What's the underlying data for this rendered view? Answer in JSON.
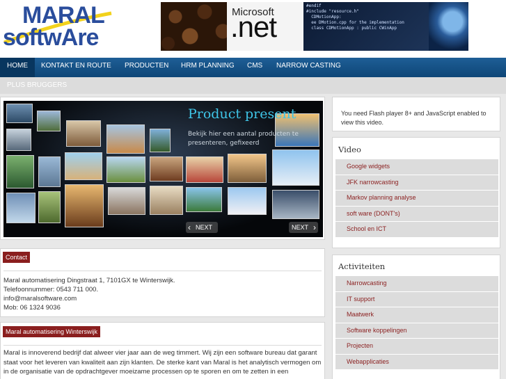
{
  "brand": {
    "logo_line1": "MARAL",
    "logo_line2": "softwAre",
    "brand_color": "#2a4d9c"
  },
  "banner": {
    "microsoft": "Microsoft",
    "net": ".net",
    "code_text": "#endif\n#include \"resource.h\"\n  CDMotionApp:\n  ee DMotion.cpp for the implementation\n  class CDMotionApp : public CWinApp"
  },
  "nav": {
    "items": [
      {
        "label": "HOME"
      },
      {
        "label": "KONTAKT EN ROUTE"
      },
      {
        "label": "PRODUCTEN"
      },
      {
        "label": "HRM PLANNING"
      },
      {
        "label": "CMS"
      },
      {
        "label": "NARROW CASTING"
      }
    ],
    "sub_item": "PLUS BRUGGERS"
  },
  "slider": {
    "title": "Product present",
    "caption": "Bekijk hier een aantal producten te presenteren, gefixeerd",
    "prev_label": "NEXT",
    "next_label": "NEXT"
  },
  "contact": {
    "label": "Contact",
    "lines": [
      "Maral automatisering Dingstraat 1, 7101GX te Winterswijk.",
      "Telefoonnummer: 0543 711 000.",
      "info@maralsoftware.com",
      "Mob: 06 1324 9036"
    ]
  },
  "about": {
    "label": "Maral automatisering Winterswijk",
    "text": "Maral is innoverend bedrijf dat alweer vier jaar aan de weg timmert. Wij zijn een software bureau dat garant staat voor het leveren van kwaliteit aan zijn klanten. De sterke kant van Maral is het analytisch vermogen om in de organisatie van de opdrachtgever moeizame processen op te sporen en om te zetten in een"
  },
  "flash": {
    "text": "You need Flash player 8+ and JavaScript enabled to view this video."
  },
  "video": {
    "heading": "Video",
    "items": [
      "Google widgets",
      "JFK narrowcasting",
      "Markov planning analyse",
      "soft ware (DONT's)",
      "School en ICT"
    ]
  },
  "activiteiten": {
    "heading": "Activiteiten",
    "items": [
      "Narrowcasting",
      "IT support",
      "Maatwerk",
      "Software koppelingen",
      "Projecten",
      "Webapplicaties"
    ]
  },
  "colors": {
    "nav": "#1e5e96",
    "accent_red": "#8a1e1e",
    "link_red": "#8a1e1e"
  }
}
